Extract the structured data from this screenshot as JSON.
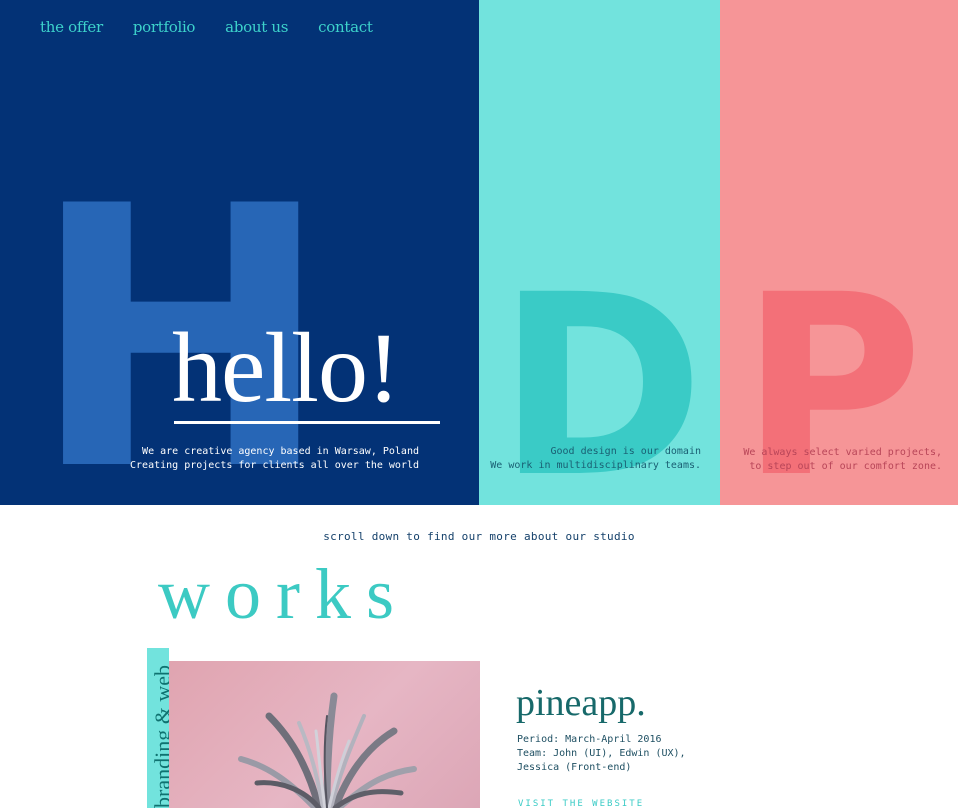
{
  "nav": {
    "items": [
      {
        "label": "the offer"
      },
      {
        "label": "portfolio"
      },
      {
        "label": "about us"
      },
      {
        "label": "contact"
      }
    ]
  },
  "hero": {
    "letters": {
      "blue": "H",
      "cyan": "D",
      "pink": "P"
    },
    "hello": "hello!",
    "blue_text": {
      "line1": "We are creative agency based in Warsaw, Poland",
      "line2": "Creating projects for clients all over the world"
    },
    "cyan_text": {
      "line1": "Good design is our domain",
      "line2": "We work in multidisciplinary teams."
    },
    "pink_text": {
      "line1": "We always select varied projects,",
      "line2": "to step out of our comfort zone."
    }
  },
  "scroll_text": "scroll down to find our more about our studio",
  "works": {
    "title": "works",
    "category": "branding & web",
    "item": {
      "name": "pineapp.",
      "period": "Period: March-April 2016",
      "team_line1": "Team: John (UI), Edwin (UX),",
      "team_line2": "Jessica (Front-end)",
      "visit": "VISIT THE WEBSITE"
    }
  },
  "colors": {
    "navy": "#033276",
    "cyan": "#72e3dd",
    "pink": "#f69597",
    "accent": "#3dd2cb"
  }
}
